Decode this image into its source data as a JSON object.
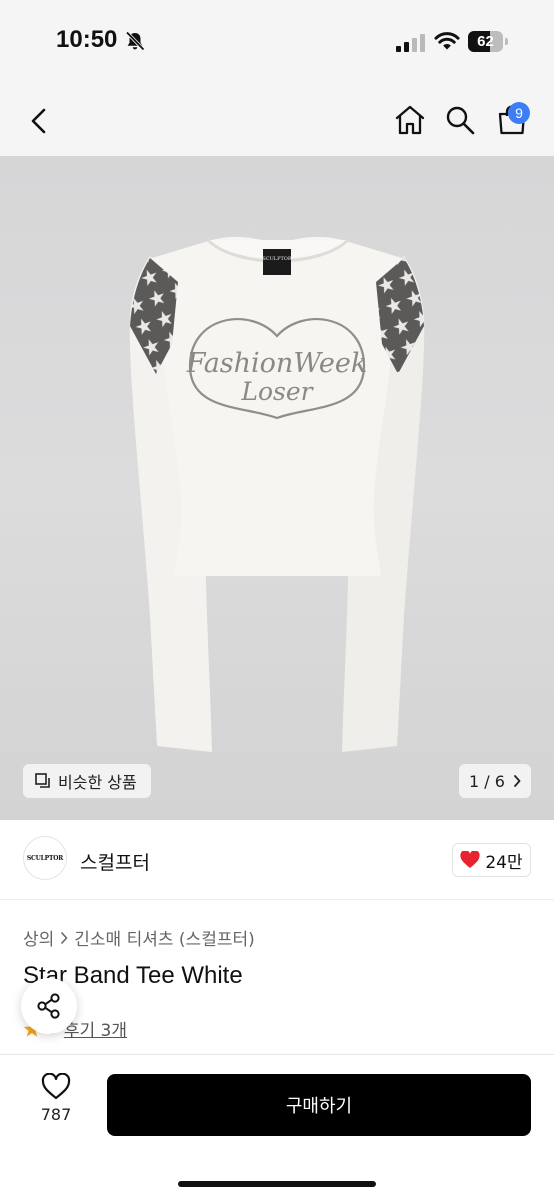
{
  "status_bar": {
    "time": "10:50",
    "battery": "62",
    "battery_level": 0.62
  },
  "nav": {
    "cart_count": "9"
  },
  "hero": {
    "shirt_label": "SCULPTOR",
    "print_line1": "FashionWeek",
    "print_line2": "Loser",
    "similar_label": "비슷한 상품",
    "pager": "1 / 6"
  },
  "brand": {
    "logo_text": "SCULPTOR",
    "name": "스컬프터",
    "likes": "24만"
  },
  "product": {
    "breadcrumb": [
      "상의",
      "긴소매 티셔츠 (스컬프터)"
    ],
    "title": "Star Band Tee White",
    "rating": "5",
    "reviews": "후기 3개"
  },
  "bottom": {
    "wish_count": "787",
    "buy_label": "구매하기"
  },
  "colors": {
    "accent": "#3d7ef7",
    "heart": "#e8222e",
    "star": "#f5a623"
  }
}
